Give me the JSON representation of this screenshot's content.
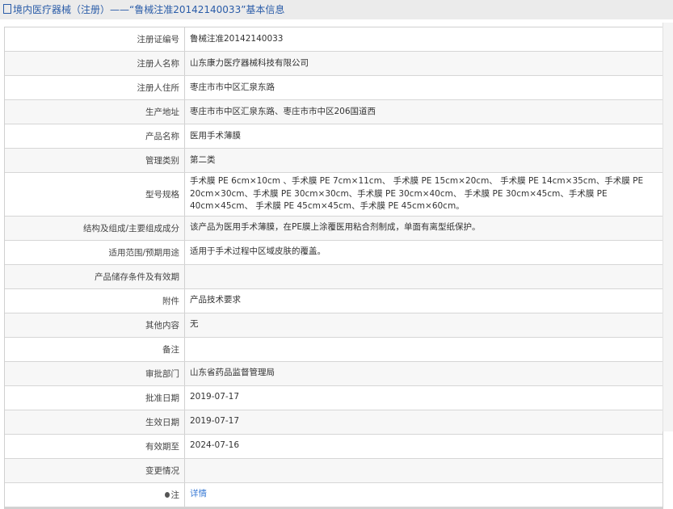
{
  "header": {
    "title": "境内医疗器械（注册）——“鲁械注准20142140033”基本信息"
  },
  "rows": [
    {
      "label": "注册证编号",
      "value": "鲁械注准20142140033"
    },
    {
      "label": "注册人名称",
      "value": "山东康力医疗器械科技有限公司"
    },
    {
      "label": "注册人住所",
      "value": "枣庄市市中区汇泉东路"
    },
    {
      "label": "生产地址",
      "value": "枣庄市市中区汇泉东路、枣庄市市中区206国道西"
    },
    {
      "label": "产品名称",
      "value": "医用手术薄膜"
    },
    {
      "label": "管理类别",
      "value": "第二类"
    },
    {
      "label": "型号规格",
      "value": "手术膜 PE 6cm×10cm 、手术膜 PE 7cm×11cm、 手术膜 PE 15cm×20cm、 手术膜 PE 14cm×35cm、手术膜 PE 20cm×30cm、手术膜 PE 30cm×30cm、手术膜 PE 30cm×40cm、 手术膜 PE 30cm×45cm、手术膜 PE 40cm×45cm、 手术膜 PE 45cm×45cm、手术膜 PE 45cm×60cm。"
    },
    {
      "label": "结构及组成/主要组成成分",
      "value": "该产品为医用手术薄膜，在PE膜上涂覆医用粘合剂制成，单面有离型纸保护。"
    },
    {
      "label": "适用范围/预期用途",
      "value": "适用于手术过程中区域皮肤的覆盖。"
    },
    {
      "label": "产品储存条件及有效期",
      "value": ""
    },
    {
      "label": "附件",
      "value": "产品技术要求"
    },
    {
      "label": "其他内容",
      "value": "无"
    },
    {
      "label": "备注",
      "value": ""
    },
    {
      "label": "审批部门",
      "value": "山东省药品监督管理局"
    },
    {
      "label": "批准日期",
      "value": "2019-07-17"
    },
    {
      "label": "生效日期",
      "value": "2019-07-17"
    },
    {
      "label": "有效期至",
      "value": "2024-07-16"
    },
    {
      "label": "变更情况",
      "value": ""
    }
  ],
  "note": {
    "label": "注",
    "link": "详情"
  }
}
